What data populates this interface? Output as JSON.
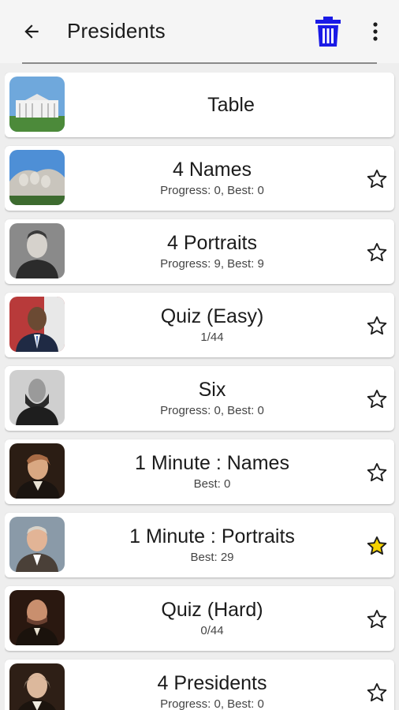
{
  "header": {
    "title": "Presidents",
    "back_icon": "arrow-back-icon",
    "trash_icon": "trash-icon",
    "more_icon": "more-vert-icon",
    "trash_color": "#1a1ae6"
  },
  "items": [
    {
      "title": "Table",
      "subtitle": "",
      "thumb": "white-house",
      "starred": null
    },
    {
      "title": "4 Names",
      "subtitle": "Progress: 0, Best: 0",
      "thumb": "mount-rushmore",
      "starred": false
    },
    {
      "title": "4 Portraits",
      "subtitle": "Progress: 9, Best: 9",
      "thumb": "portrait-kennedy",
      "starred": false
    },
    {
      "title": "Quiz (Easy)",
      "subtitle": "1/44",
      "thumb": "portrait-obama",
      "starred": false
    },
    {
      "title": "Six",
      "subtitle": "Progress: 0, Best: 0",
      "thumb": "portrait-lincoln",
      "starred": false
    },
    {
      "title": "1 Minute : Names",
      "subtitle": "Best: 0",
      "thumb": "portrait-jefferson",
      "starred": false
    },
    {
      "title": "1 Minute : Portraits",
      "subtitle": "Best: 29",
      "thumb": "portrait-eisenhower",
      "starred": true
    },
    {
      "title": "Quiz (Hard)",
      "subtitle": "0/44",
      "thumb": "portrait-arthur",
      "starred": false
    },
    {
      "title": "4 Presidents",
      "subtitle": "Progress: 0, Best: 0",
      "thumb": "portrait-madison",
      "starred": false
    }
  ],
  "colors": {
    "star_filled": "#f5d200",
    "star_outline": "#1b1b1b"
  }
}
